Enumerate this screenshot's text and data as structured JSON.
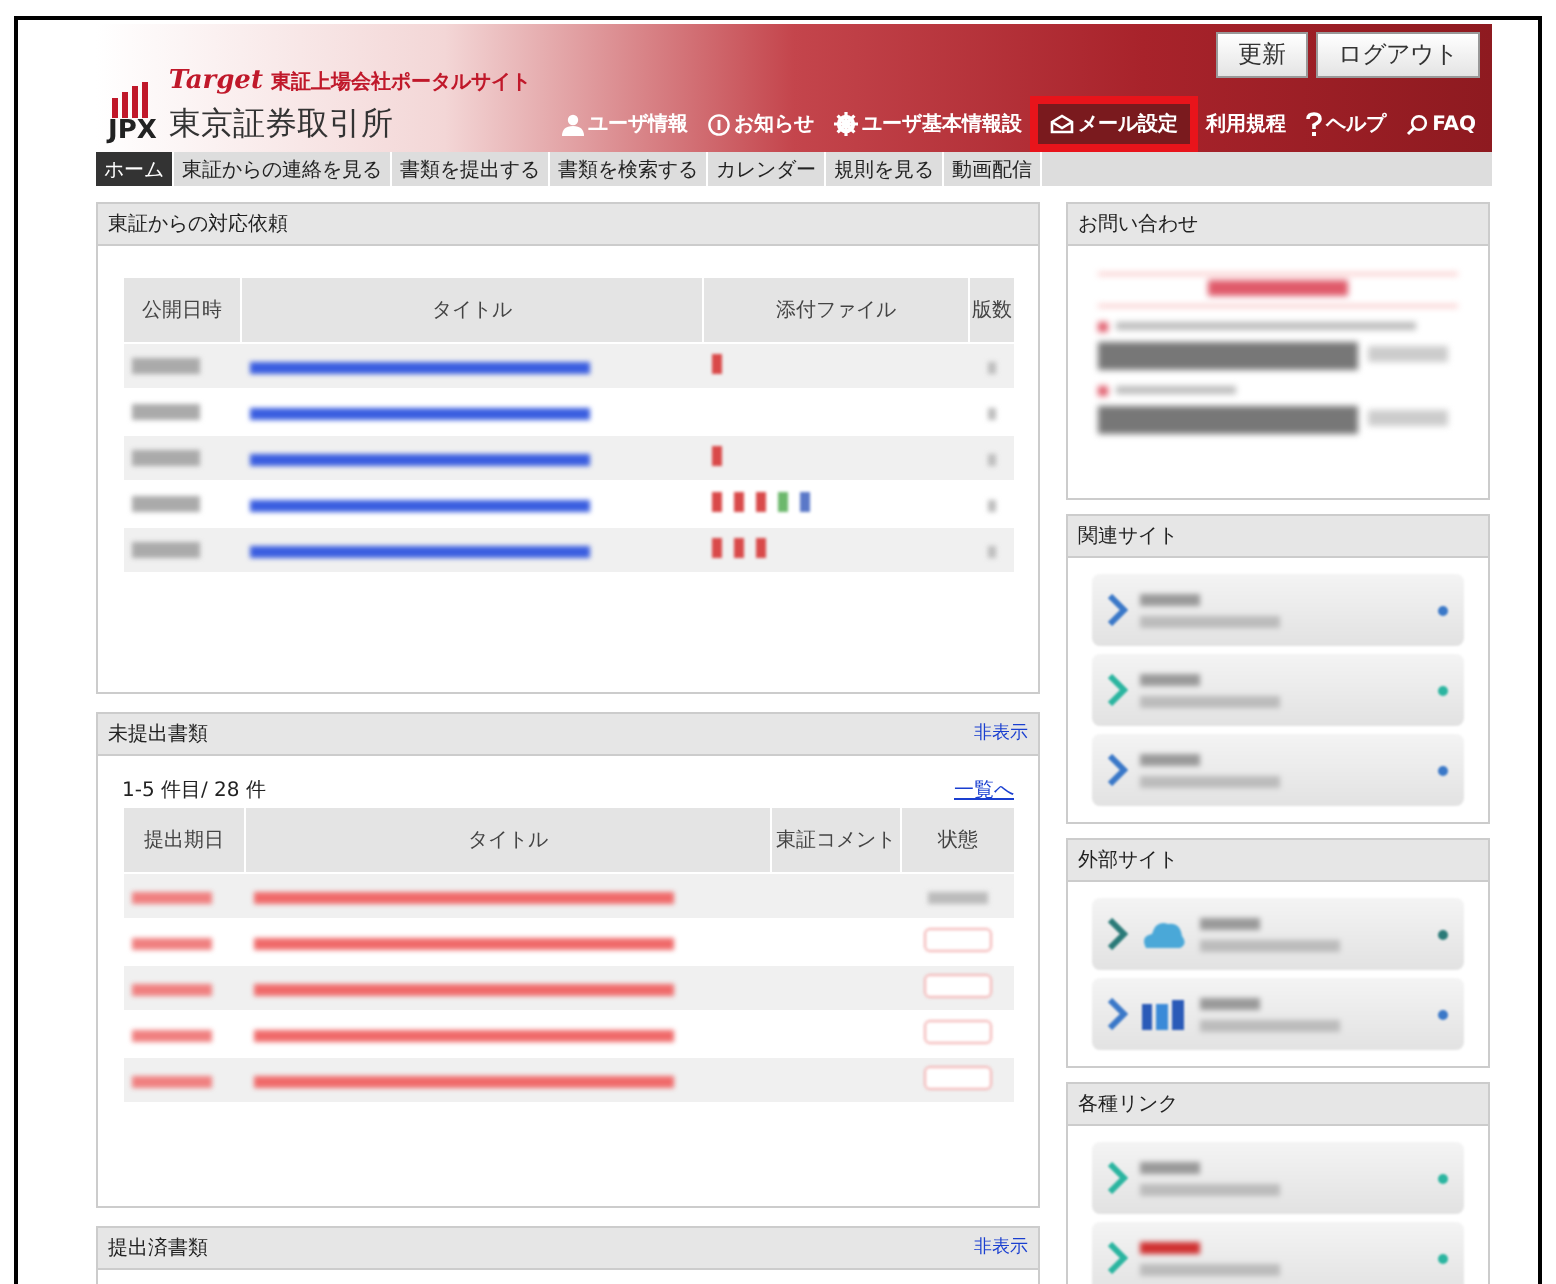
{
  "header": {
    "logo": "JPX",
    "portal_brand": "Target",
    "portal_title": "東証上場会社ポータルサイト",
    "exchange_name": "東京証券取引所",
    "buttons": [
      "更新",
      "ログアウト"
    ],
    "menu": [
      {
        "kind": "user",
        "label": "ユーザ情報",
        "highlighted": false
      },
      {
        "kind": "notice",
        "label": "お知らせ",
        "highlighted": false
      },
      {
        "kind": "gear",
        "label": "ユーザ基本情報設",
        "highlighted": false
      },
      {
        "kind": "mail",
        "label": "メール設定",
        "highlighted": true
      },
      {
        "kind": "plain",
        "label": "利用規程",
        "highlighted": false
      },
      {
        "kind": "help",
        "label": "ヘルプ",
        "highlighted": false
      },
      {
        "kind": "faq",
        "label": "FAQ",
        "highlighted": false
      }
    ]
  },
  "nav": [
    {
      "label": "ホーム",
      "selected": true
    },
    {
      "label": "東証からの連絡を見る",
      "selected": false
    },
    {
      "label": "書類を提出する",
      "selected": false
    },
    {
      "label": "書類を検索する",
      "selected": false
    },
    {
      "label": "カレンダー",
      "selected": false
    },
    {
      "label": "規則を見る",
      "selected": false
    },
    {
      "label": "動画配信",
      "selected": false
    }
  ],
  "requests": {
    "title": "東証からの対応依頼",
    "columns": [
      "公開日時",
      "タイトル",
      "添付ファイル",
      "版数"
    ],
    "rows": [
      {
        "kind": "blurred",
        "attachments": [
          {
            "color": "#d94a4a"
          }
        ]
      },
      {
        "kind": "blurred"
      },
      {
        "kind": "blurred",
        "attachments": [
          {
            "color": "#d94a4a"
          }
        ]
      },
      {
        "kind": "blurred",
        "attachments": [
          {
            "color": "#d94a4a"
          },
          {
            "color": "#d94a4a"
          },
          {
            "color": "#d94a4a"
          },
          {
            "color": "#6cb86c"
          },
          {
            "color": "#5a78c8"
          }
        ]
      },
      {
        "kind": "blurred",
        "attachments": [
          {
            "color": "#d94a4a"
          },
          {
            "color": "#d94a4a"
          },
          {
            "color": "#d94a4a"
          }
        ]
      }
    ]
  },
  "pending": {
    "title": "未提出書類",
    "toggle": "非表示",
    "count": "1-5 件目/ 28 件",
    "list_link": "一覧へ",
    "columns": [
      "提出期日",
      "タイトル",
      "東証コメント",
      "状態"
    ],
    "rows": [
      {
        "kind": "plain"
      },
      {
        "kind": "badge"
      },
      {
        "kind": "badge"
      },
      {
        "kind": "badge"
      },
      {
        "kind": "badge"
      }
    ]
  },
  "submitted": {
    "title": "提出済書類",
    "toggle": "非表示"
  },
  "contact": {
    "title": "お問い合わせ"
  },
  "related": {
    "title": "関連サイト",
    "links": [
      {
        "kind": "plain",
        "color": "#3a78c8"
      },
      {
        "kind": "plain",
        "color": "#2bb5a0"
      },
      {
        "kind": "plain",
        "color": "#3a78c8"
      }
    ]
  },
  "external": {
    "title": "外部サイト",
    "links": [
      {
        "kind": "cloud-logo",
        "color": "#2a7a78"
      },
      {
        "kind": "icj-logo",
        "color": "#3a78c8"
      }
    ]
  },
  "misc": {
    "title": "各種リンク",
    "links": [
      {
        "kind": "plain",
        "color": "#2bb5a0"
      },
      {
        "kind": "red-text",
        "color": "#2bb5a0"
      }
    ]
  }
}
